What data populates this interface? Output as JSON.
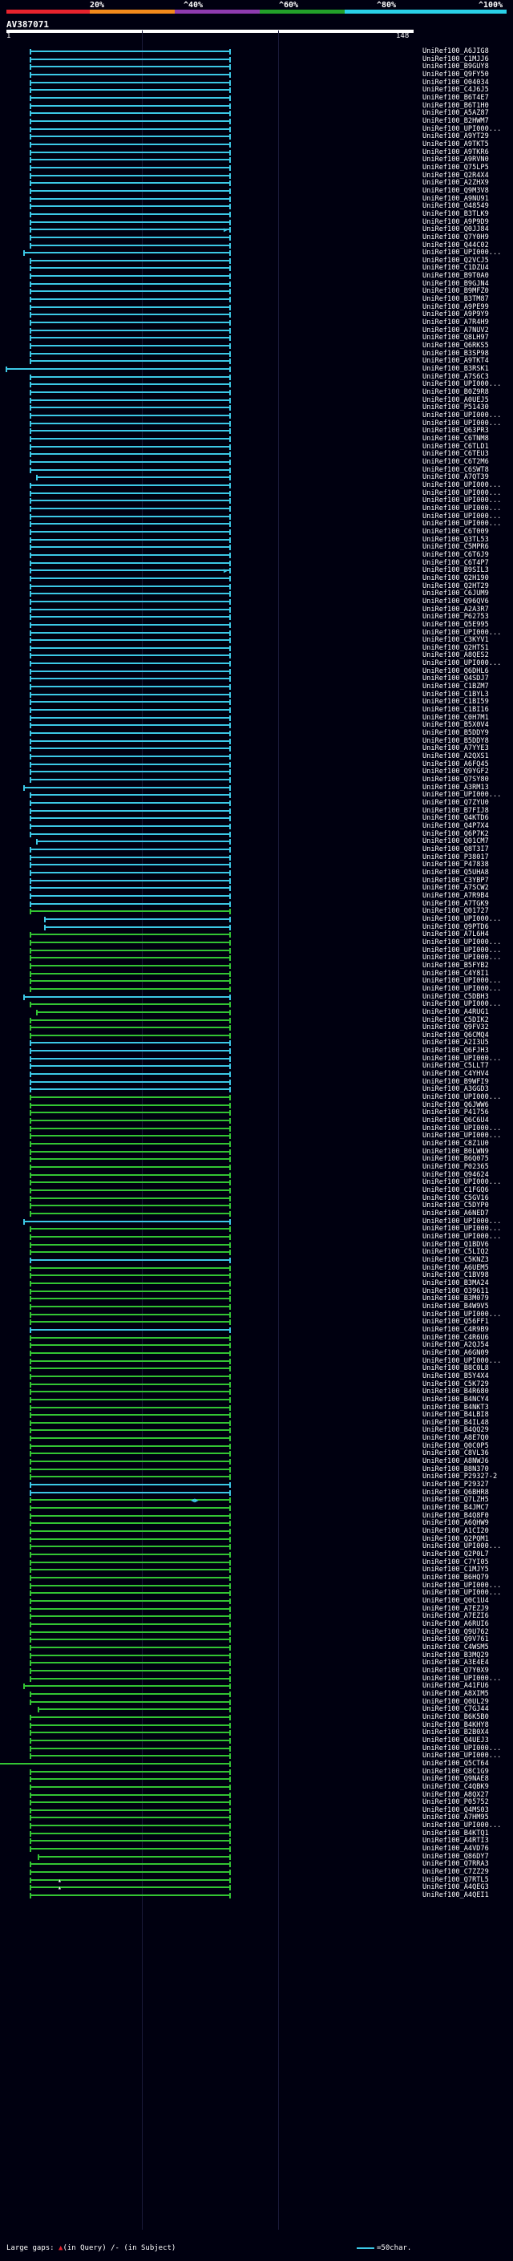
{
  "legend": {
    "ticks": [
      "20%",
      "^40%",
      "^60%",
      "^80%",
      "^100%"
    ],
    "colors": [
      "#e8232d",
      "#f28a1c",
      "#8e3bb0",
      "#23a02a",
      "#2ad0e8"
    ]
  },
  "query": {
    "id": "AV387071",
    "start": "1",
    "end": "148"
  },
  "colors": {
    "cyan": "#3cc8e6",
    "green": "#33c433",
    "white": "#ffffff"
  },
  "hits": [
    {
      "name": "UniRef100_A6JIG8",
      "c": "cyan"
    },
    {
      "name": "UniRef100_C1MJJ6",
      "c": "cyan"
    },
    {
      "name": "UniRef100_B9GUY8",
      "c": "cyan"
    },
    {
      "name": "UniRef100_Q9FY50",
      "c": "cyan"
    },
    {
      "name": "UniRef100_O04034",
      "c": "cyan"
    },
    {
      "name": "UniRef100_C4J6J5",
      "c": "cyan"
    },
    {
      "name": "UniRef100_B6T4E7",
      "c": "cyan"
    },
    {
      "name": "UniRef100_B6T1H0",
      "c": "cyan"
    },
    {
      "name": "UniRef100_A5AZ87",
      "c": "cyan"
    },
    {
      "name": "UniRef100_B2HWM7",
      "c": "cyan"
    },
    {
      "name": "UniRef100_UPI000...",
      "c": "cyan"
    },
    {
      "name": "UniRef100_A9YT29",
      "c": "cyan"
    },
    {
      "name": "UniRef100_A9TKT5",
      "c": "cyan"
    },
    {
      "name": "UniRef100_A9TKR6",
      "c": "cyan"
    },
    {
      "name": "UniRef100_A9RVN0",
      "c": "cyan"
    },
    {
      "name": "UniRef100_Q75LP5",
      "c": "cyan"
    },
    {
      "name": "UniRef100_Q2R4X4",
      "c": "cyan"
    },
    {
      "name": "UniRef100_A2ZHX9",
      "c": "cyan"
    },
    {
      "name": "UniRef100_Q9M3V8",
      "c": "cyan"
    },
    {
      "name": "UniRef100_A9NU91",
      "c": "cyan"
    },
    {
      "name": "UniRef100_O48549",
      "c": "cyan"
    },
    {
      "name": "UniRef100_B3TLK9",
      "c": "cyan"
    },
    {
      "name": "UniRef100_A9P9D9",
      "c": "cyan"
    },
    {
      "name": "UniRef100_Q0JJ84",
      "c": "cyan",
      "a": true
    },
    {
      "name": "UniRef100_Q7Y0H9",
      "c": "cyan"
    },
    {
      "name": "UniRef100_Q44C02",
      "c": "cyan"
    },
    {
      "name": "UniRef100_UPI000...",
      "c": "cyan",
      "s": -8
    },
    {
      "name": "UniRef100_Q2VCJ5",
      "c": "cyan"
    },
    {
      "name": "UniRef100_C1DZU4",
      "c": "cyan"
    },
    {
      "name": "UniRef100_B9T0A0",
      "c": "cyan"
    },
    {
      "name": "UniRef100_B9GJN4",
      "c": "cyan"
    },
    {
      "name": "UniRef100_B9MFZ0",
      "c": "cyan"
    },
    {
      "name": "UniRef100_B3TM87",
      "c": "cyan"
    },
    {
      "name": "UniRef100_A9PE99",
      "c": "cyan"
    },
    {
      "name": "UniRef100_A9P9Y9",
      "c": "cyan"
    },
    {
      "name": "UniRef100_A7R4H9",
      "c": "cyan"
    },
    {
      "name": "UniRef100_A7NUV2",
      "c": "cyan"
    },
    {
      "name": "UniRef100_Q8LH97",
      "c": "cyan"
    },
    {
      "name": "UniRef100_Q6RKS5",
      "c": "cyan"
    },
    {
      "name": "UniRef100_B3SP98",
      "c": "cyan"
    },
    {
      "name": "UniRef100_A9TKT4",
      "c": "cyan"
    },
    {
      "name": "UniRef100_B3RSK1",
      "c": "cyan",
      "s": -30
    },
    {
      "name": "UniRef100_A7S6C3",
      "c": "cyan"
    },
    {
      "name": "UniRef100_UPI000...",
      "c": "cyan"
    },
    {
      "name": "UniRef100_B0Z9R8",
      "c": "cyan"
    },
    {
      "name": "UniRef100_A0UEJ5",
      "c": "cyan"
    },
    {
      "name": "UniRef100_P51430",
      "c": "cyan"
    },
    {
      "name": "UniRef100_UPI000...",
      "c": "cyan"
    },
    {
      "name": "UniRef100_UPI000...",
      "c": "cyan"
    },
    {
      "name": "UniRef100_Q63PR3",
      "c": "cyan"
    },
    {
      "name": "UniRef100_C6TNM8",
      "c": "cyan"
    },
    {
      "name": "UniRef100_C6TLD1",
      "c": "cyan"
    },
    {
      "name": "UniRef100_C6TEU3",
      "c": "cyan"
    },
    {
      "name": "UniRef100_C6T2M6",
      "c": "cyan"
    },
    {
      "name": "UniRef100_C6SWT8",
      "c": "cyan"
    },
    {
      "name": "UniRef100_A7QT39",
      "c": "cyan",
      "s": 8
    },
    {
      "name": "UniRef100_UPI000...",
      "c": "cyan"
    },
    {
      "name": "UniRef100_UPI000...",
      "c": "cyan"
    },
    {
      "name": "UniRef100_UPI000...",
      "c": "cyan"
    },
    {
      "name": "UniRef100_UPI000...",
      "c": "cyan"
    },
    {
      "name": "UniRef100_UPI000...",
      "c": "cyan"
    },
    {
      "name": "UniRef100_UPI000...",
      "c": "cyan"
    },
    {
      "name": "UniRef100_C6T009",
      "c": "cyan"
    },
    {
      "name": "UniRef100_Q3TL53",
      "c": "cyan"
    },
    {
      "name": "UniRef100_C5MPR6",
      "c": "cyan"
    },
    {
      "name": "UniRef100_C6T6J9",
      "c": "cyan"
    },
    {
      "name": "UniRef100_C6T4P7",
      "c": "cyan"
    },
    {
      "name": "UniRef100_B9SIL3",
      "c": "cyan",
      "a": true
    },
    {
      "name": "UniRef100_Q2H190",
      "c": "cyan"
    },
    {
      "name": "UniRef100_Q2HT29",
      "c": "cyan"
    },
    {
      "name": "UniRef100_C6JUM9",
      "c": "cyan"
    },
    {
      "name": "UniRef100_Q96QV6",
      "c": "cyan"
    },
    {
      "name": "UniRef100_A2A3R7",
      "c": "cyan"
    },
    {
      "name": "UniRef100_P62753",
      "c": "cyan"
    },
    {
      "name": "UniRef100_Q5E995",
      "c": "cyan"
    },
    {
      "name": "UniRef100_UPI000...",
      "c": "cyan"
    },
    {
      "name": "UniRef100_C3KYV1",
      "c": "cyan"
    },
    {
      "name": "UniRef100_Q2HTS1",
      "c": "cyan"
    },
    {
      "name": "UniRef100_A8QES2",
      "c": "cyan"
    },
    {
      "name": "UniRef100_UPI000...",
      "c": "cyan"
    },
    {
      "name": "UniRef100_Q6DHL6",
      "c": "cyan"
    },
    {
      "name": "UniRef100_Q4SDJ7",
      "c": "cyan"
    },
    {
      "name": "UniRef100_C1BZM7",
      "c": "cyan"
    },
    {
      "name": "UniRef100_C1BYL3",
      "c": "cyan"
    },
    {
      "name": "UniRef100_C1BI59",
      "c": "cyan"
    },
    {
      "name": "UniRef100_C1BI16",
      "c": "cyan"
    },
    {
      "name": "UniRef100_C0H7M1",
      "c": "cyan"
    },
    {
      "name": "UniRef100_B5X0V4",
      "c": "cyan"
    },
    {
      "name": "UniRef100_B5DDY9",
      "c": "cyan"
    },
    {
      "name": "UniRef100_B5DDY8",
      "c": "cyan"
    },
    {
      "name": "UniRef100_A7YYE3",
      "c": "cyan"
    },
    {
      "name": "UniRef100_A2QXS1",
      "c": "cyan"
    },
    {
      "name": "UniRef100_A6FQ45",
      "c": "cyan"
    },
    {
      "name": "UniRef100_Q9YGF2",
      "c": "cyan"
    },
    {
      "name": "UniRef100_Q7SY80",
      "c": "cyan"
    },
    {
      "name": "UniRef100_A3RM13",
      "c": "cyan",
      "s": -8
    },
    {
      "name": "UniRef100_UPI000...",
      "c": "cyan"
    },
    {
      "name": "UniRef100_Q7ZYU0",
      "c": "cyan"
    },
    {
      "name": "UniRef100_B7FIJ8",
      "c": "cyan"
    },
    {
      "name": "UniRef100_Q4KTD6",
      "c": "cyan"
    },
    {
      "name": "UniRef100_Q4P7X4",
      "c": "cyan"
    },
    {
      "name": "UniRef100_Q6P7K2",
      "c": "cyan"
    },
    {
      "name": "UniRef100_Q01CM7",
      "c": "cyan",
      "s": 8
    },
    {
      "name": "UniRef100_Q8T3I7",
      "c": "cyan"
    },
    {
      "name": "UniRef100_P38017",
      "c": "cyan"
    },
    {
      "name": "UniRef100_P47838",
      "c": "cyan"
    },
    {
      "name": "UniRef100_Q5UHA8",
      "c": "cyan"
    },
    {
      "name": "UniRef100_C3YBP7",
      "c": "cyan"
    },
    {
      "name": "UniRef100_A7SCW2",
      "c": "cyan"
    },
    {
      "name": "UniRef100_A7R9B4",
      "c": "cyan"
    },
    {
      "name": "UniRef100_A7TGK9",
      "c": "cyan"
    },
    {
      "name": "UniRef100_Q01727",
      "c": "green"
    },
    {
      "name": "UniRef100_UPI000...",
      "c": "cyan",
      "s": 18
    },
    {
      "name": "UniRef100_Q9PTD6",
      "c": "cyan",
      "s": 18
    },
    {
      "name": "UniRef100_A7L6H4",
      "c": "green"
    },
    {
      "name": "UniRef100_UPI000...",
      "c": "green"
    },
    {
      "name": "UniRef100_UPI000...",
      "c": "green"
    },
    {
      "name": "UniRef100_UPI000...",
      "c": "green"
    },
    {
      "name": "UniRef100_B5FYB2",
      "c": "green"
    },
    {
      "name": "UniRef100_C4Y8I1",
      "c": "green"
    },
    {
      "name": "UniRef100_UPI000...",
      "c": "green"
    },
    {
      "name": "UniRef100_UPI000...",
      "c": "green"
    },
    {
      "name": "UniRef100_C5DBH3",
      "c": "cyan",
      "s": -8
    },
    {
      "name": "UniRef100_UPI000...",
      "c": "green"
    },
    {
      "name": "UniRef100_A4RUG1",
      "c": "green",
      "s": 8
    },
    {
      "name": "UniRef100_C5DIK2",
      "c": "green"
    },
    {
      "name": "UniRef100_Q9FV32",
      "c": "green"
    },
    {
      "name": "UniRef100_Q6CMQ4",
      "c": "green"
    },
    {
      "name": "UniRef100_A2I3U5",
      "c": "cyan"
    },
    {
      "name": "UniRef100_Q6FJH3",
      "c": "cyan"
    },
    {
      "name": "UniRef100_UPI000...",
      "c": "cyan"
    },
    {
      "name": "UniRef100_C5LLT7",
      "c": "cyan"
    },
    {
      "name": "UniRef100_C4YHV4",
      "c": "cyan"
    },
    {
      "name": "UniRef100_B9WFI9",
      "c": "cyan"
    },
    {
      "name": "UniRef100_A3GGD3",
      "c": "cyan"
    },
    {
      "name": "UniRef100_UPI000...",
      "c": "green"
    },
    {
      "name": "UniRef100_Q6JWW6",
      "c": "green"
    },
    {
      "name": "UniRef100_P41756",
      "c": "green"
    },
    {
      "name": "UniRef100_Q6C6U4",
      "c": "green"
    },
    {
      "name": "UniRef100_UPI000...",
      "c": "green"
    },
    {
      "name": "UniRef100_UPI000...",
      "c": "green"
    },
    {
      "name": "UniRef100_C8Z1U0",
      "c": "green"
    },
    {
      "name": "UniRef100_B0LWN9",
      "c": "green"
    },
    {
      "name": "UniRef100_B6Q075",
      "c": "green"
    },
    {
      "name": "UniRef100_P02365",
      "c": "green"
    },
    {
      "name": "UniRef100_Q94624",
      "c": "green"
    },
    {
      "name": "UniRef100_UPI000...",
      "c": "green"
    },
    {
      "name": "UniRef100_C1FGQ6",
      "c": "green"
    },
    {
      "name": "UniRef100_C5GV16",
      "c": "green"
    },
    {
      "name": "UniRef100_C5DYP0",
      "c": "green"
    },
    {
      "name": "UniRef100_A6NED7",
      "c": "green"
    },
    {
      "name": "UniRef100_UPI000...",
      "c": "cyan",
      "s": -8
    },
    {
      "name": "UniRef100_UPI000...",
      "c": "green"
    },
    {
      "name": "UniRef100_UPI000...",
      "c": "green"
    },
    {
      "name": "UniRef100_Q1BDV6",
      "c": "green"
    },
    {
      "name": "UniRef100_C5LIQ2",
      "c": "green"
    },
    {
      "name": "UniRef100_C5KNZ3",
      "c": "cyan"
    },
    {
      "name": "UniRef100_A6UEM5",
      "c": "green"
    },
    {
      "name": "UniRef100_C1BV98",
      "c": "green"
    },
    {
      "name": "UniRef100_B3MA24",
      "c": "green"
    },
    {
      "name": "UniRef100_O39611",
      "c": "green"
    },
    {
      "name": "UniRef100_B3M079",
      "c": "green"
    },
    {
      "name": "UniRef100_B4W9V5",
      "c": "green"
    },
    {
      "name": "UniRef100_UPI000...",
      "c": "green"
    },
    {
      "name": "UniRef100_Q56FF1",
      "c": "green"
    },
    {
      "name": "UniRef100_C4R9B9",
      "c": "cyan"
    },
    {
      "name": "UniRef100_C4R6U6",
      "c": "green"
    },
    {
      "name": "UniRef100_A2QJ54",
      "c": "green"
    },
    {
      "name": "UniRef100_A6GN09",
      "c": "green"
    },
    {
      "name": "UniRef100_UPI000...",
      "c": "green"
    },
    {
      "name": "UniRef100_B8C0L8",
      "c": "green"
    },
    {
      "name": "UniRef100_B5Y4X4",
      "c": "green"
    },
    {
      "name": "UniRef100_C5K729",
      "c": "green"
    },
    {
      "name": "UniRef100_B4R680",
      "c": "green"
    },
    {
      "name": "UniRef100_B4NCY4",
      "c": "green"
    },
    {
      "name": "UniRef100_B4NKT3",
      "c": "green"
    },
    {
      "name": "UniRef100_B4LBI8",
      "c": "green"
    },
    {
      "name": "UniRef100_B4IL48",
      "c": "green"
    },
    {
      "name": "UniRef100_B4QQ29",
      "c": "green"
    },
    {
      "name": "UniRef100_A8E7Q0",
      "c": "green"
    },
    {
      "name": "UniRef100_Q0C0P5",
      "c": "green"
    },
    {
      "name": "UniRef100_C8VL36",
      "c": "green"
    },
    {
      "name": "UniRef100_A8NWJ6",
      "c": "green"
    },
    {
      "name": "UniRef100_B8N370",
      "c": "green"
    },
    {
      "name": "UniRef100_P29327-2",
      "c": "green"
    },
    {
      "name": "UniRef100_P29327",
      "c": "cyan"
    },
    {
      "name": "UniRef100_Q6BHR8",
      "c": "cyan"
    },
    {
      "name": "UniRef100_Q7LZH5",
      "c": "green",
      "a": "mid"
    },
    {
      "name": "UniRef100_B4JMC7",
      "c": "green"
    },
    {
      "name": "UniRef100_B4Q8F0",
      "c": "green"
    },
    {
      "name": "UniRef100_A6QHW9",
      "c": "green"
    },
    {
      "name": "UniRef100_A1CI20",
      "c": "green"
    },
    {
      "name": "UniRef100_Q2PQM1",
      "c": "green"
    },
    {
      "name": "UniRef100_UPI000...",
      "c": "green"
    },
    {
      "name": "UniRef100_Q2P0L7",
      "c": "green"
    },
    {
      "name": "UniRef100_C7YI05",
      "c": "green"
    },
    {
      "name": "UniRef100_C1MJY5",
      "c": "green"
    },
    {
      "name": "UniRef100_B6HQ79",
      "c": "green"
    },
    {
      "name": "UniRef100_UPI000...",
      "c": "green"
    },
    {
      "name": "UniRef100_UPI000...",
      "c": "green"
    },
    {
      "name": "UniRef100_Q0C1U4",
      "c": "green"
    },
    {
      "name": "UniRef100_A7EZJ9",
      "c": "green"
    },
    {
      "name": "UniRef100_A7EZI6",
      "c": "green"
    },
    {
      "name": "UniRef100_A6RUI6",
      "c": "green"
    },
    {
      "name": "UniRef100_Q9U762",
      "c": "green"
    },
    {
      "name": "UniRef100_Q9V761",
      "c": "green"
    },
    {
      "name": "UniRef100_C4WSM5",
      "c": "green"
    },
    {
      "name": "UniRef100_B3MQ29",
      "c": "green"
    },
    {
      "name": "UniRef100_A3E4E4",
      "c": "green"
    },
    {
      "name": "UniRef100_Q7Y0X9",
      "c": "green"
    },
    {
      "name": "UniRef100_UPI000...",
      "c": "green"
    },
    {
      "name": "UniRef100_A41FU6",
      "c": "green",
      "s": -8
    },
    {
      "name": "UniRef100_A8XIM5",
      "c": "green"
    },
    {
      "name": "UniRef100_Q0UL29",
      "c": "green"
    },
    {
      "name": "UniRef100_C7GJ44",
      "c": "green",
      "s": 10
    },
    {
      "name": "UniRef100_B6K5B0",
      "c": "green"
    },
    {
      "name": "UniRef100_B4KHY8",
      "c": "green"
    },
    {
      "name": "UniRef100_B2B0X4",
      "c": "green"
    },
    {
      "name": "UniRef100_Q4UEJ3",
      "c": "green"
    },
    {
      "name": "UniRef100_UPI000...",
      "c": "green"
    },
    {
      "name": "UniRef100_UPI000...",
      "c": "green"
    },
    {
      "name": "UniRef100_Q5CT64",
      "c": "green",
      "s": -40
    },
    {
      "name": "UniRef100_Q8C1G9",
      "c": "green"
    },
    {
      "name": "UniRef100_Q9NAE8",
      "c": "green"
    },
    {
      "name": "UniRef100_C4QBK9",
      "c": "green"
    },
    {
      "name": "UniRef100_A8QX27",
      "c": "green"
    },
    {
      "name": "UniRef100_P05752",
      "c": "green"
    },
    {
      "name": "UniRef100_Q4MS03",
      "c": "green"
    },
    {
      "name": "UniRef100_A7HM95",
      "c": "green"
    },
    {
      "name": "UniRef100_UPI000...",
      "c": "green"
    },
    {
      "name": "UniRef100_B4KTQ1",
      "c": "green"
    },
    {
      "name": "UniRef100_A4RTI3",
      "c": "green"
    },
    {
      "name": "UniRef100_A4VD76",
      "c": "green"
    },
    {
      "name": "UniRef100_Q86DY7",
      "c": "green",
      "s": 10
    },
    {
      "name": "UniRef100_Q7RRA3",
      "c": "green"
    },
    {
      "name": "UniRef100_C7ZZ29",
      "c": "green"
    },
    {
      "name": "UniRef100_Q7RTL5",
      "c": "green",
      "a": "dot"
    },
    {
      "name": "UniRef100_A4QEG3",
      "c": "green",
      "a": "dot"
    },
    {
      "name": "UniRef100_A4QEI1",
      "c": "green"
    }
  ],
  "footer": {
    "large_gaps": "Large gaps:",
    "in_query": "(in Query)",
    "in_subject": "/- (in Subject)",
    "scale": "=50char."
  }
}
